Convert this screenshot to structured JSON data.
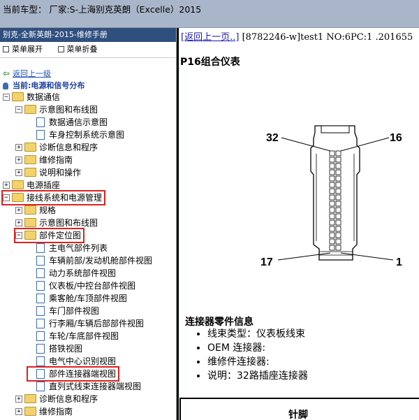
{
  "window": {
    "title": "当前车型： 厂家:S-上海别克英朗（Excelle）2015"
  },
  "sidebar": {
    "header": "别克-全新英朗-2015-维修手册",
    "expand_all": "菜单展开",
    "collapse_all": "菜单折叠",
    "back": "返回上一级",
    "current": "当前:电源和信号分布",
    "items": [
      {
        "label": "数据通信",
        "indent": 0,
        "type": "folder",
        "toggle": "−"
      },
      {
        "label": "示意图和布线图",
        "indent": 1,
        "type": "folder",
        "toggle": "−"
      },
      {
        "label": "数据通信示意图",
        "indent": 2,
        "type": "page"
      },
      {
        "label": "车身控制系统示意图",
        "indent": 2,
        "type": "page"
      },
      {
        "label": "诊断信息和程序",
        "indent": 1,
        "type": "folder",
        "toggle": "+"
      },
      {
        "label": "维修指南",
        "indent": 1,
        "type": "folder",
        "toggle": "+"
      },
      {
        "label": "说明和操作",
        "indent": 1,
        "type": "folder",
        "toggle": "+"
      },
      {
        "label": "电源插座",
        "indent": 0,
        "type": "folder",
        "toggle": "+"
      },
      {
        "label": "接线系统和电源管理",
        "indent": 0,
        "type": "folder",
        "toggle": "−"
      },
      {
        "label": "规格",
        "indent": 1,
        "type": "folder",
        "toggle": "+"
      },
      {
        "label": "示意图和布线图",
        "indent": 1,
        "type": "folder",
        "toggle": "+"
      },
      {
        "label": "部件定位图",
        "indent": 1,
        "type": "folder",
        "toggle": "−"
      },
      {
        "label": "主电气部件列表",
        "indent": 2,
        "type": "page"
      },
      {
        "label": "车辆前部/发动机舱部件视图",
        "indent": 2,
        "type": "page"
      },
      {
        "label": "动力系统部件视图",
        "indent": 2,
        "type": "page"
      },
      {
        "label": "仪表板/中控台部件视图",
        "indent": 2,
        "type": "page"
      },
      {
        "label": "乘客舱/车顶部件视图",
        "indent": 2,
        "type": "page"
      },
      {
        "label": "车门部件视图",
        "indent": 2,
        "type": "page"
      },
      {
        "label": "行李厢/车辆后部部件视图",
        "indent": 2,
        "type": "page"
      },
      {
        "label": "车轮/车底部件视图",
        "indent": 2,
        "type": "page"
      },
      {
        "label": "搭铁视图",
        "indent": 2,
        "type": "page"
      },
      {
        "label": "电气中心识别视图",
        "indent": 2,
        "type": "page"
      },
      {
        "label": "部件连接器端视图",
        "indent": 2,
        "type": "page"
      },
      {
        "label": "直列式线束连接器端视图",
        "indent": 2,
        "type": "page"
      },
      {
        "label": "诊断信息和程序",
        "indent": 1,
        "type": "folder",
        "toggle": "+"
      },
      {
        "label": "维修指南",
        "indent": 1,
        "type": "folder",
        "toggle": "+"
      }
    ]
  },
  "content": {
    "back_link": "[返回上一页..]",
    "doc_info": "[8782246-w]test1 NO:6PC:1 .201655",
    "title": "P16组合仪表",
    "pins": {
      "top_left": "32",
      "top_right": "16",
      "bottom_left": "17",
      "bottom_right": "1"
    },
    "section_title": "连接器零件信息",
    "info": [
      "线束类型：仪表板线束",
      "OEM 连接器:",
      "维修件连接器:",
      "说明：32路插座连接器"
    ],
    "table_header": "针脚"
  },
  "colors": {
    "highlight": "#e02020",
    "sidebar_header": "#2f4f7f",
    "link": "#1a53b0"
  }
}
